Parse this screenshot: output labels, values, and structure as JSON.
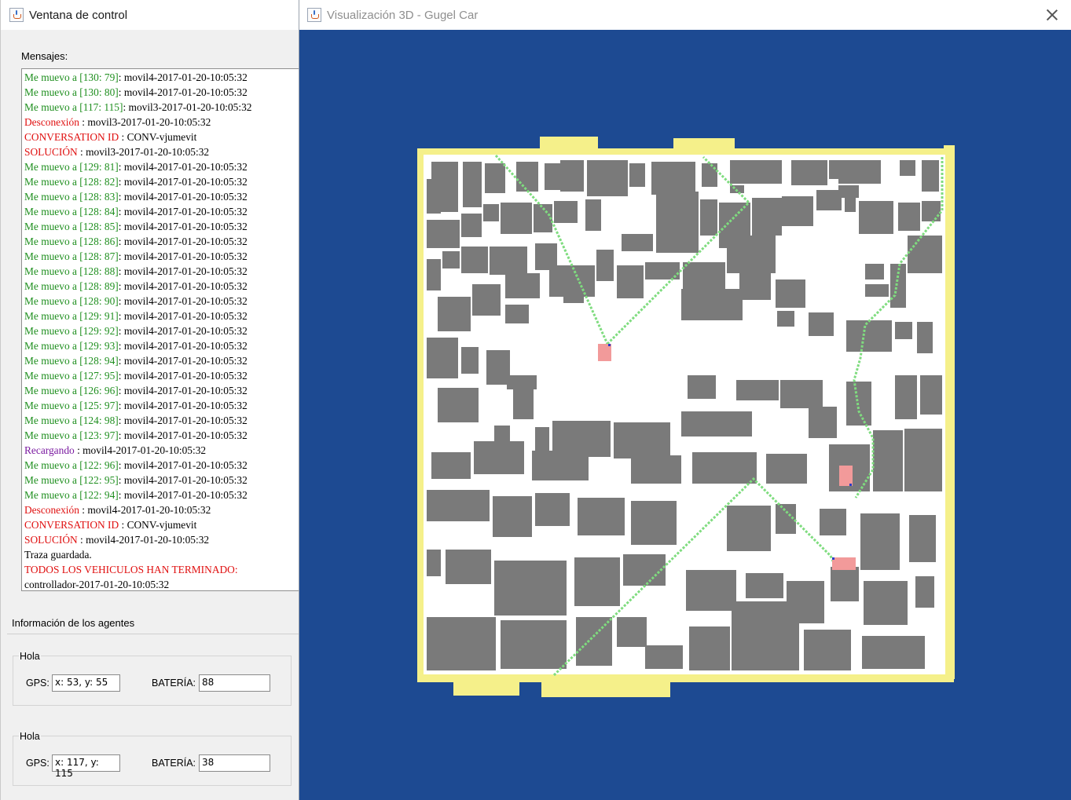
{
  "control_window": {
    "title": "Ventana de control",
    "messages_label": "Mensajes:",
    "messages": [
      {
        "tag": "Me muevo a [130: 79]",
        "sep": ": ",
        "text": "movil4-2017-01-20-10:05:32",
        "color": "green"
      },
      {
        "tag": "Me muevo a [130: 80]",
        "sep": ": ",
        "text": "movil4-2017-01-20-10:05:32",
        "color": "green"
      },
      {
        "tag": "Me muevo a [117: 115]",
        "sep": ": ",
        "text": "movil3-2017-01-20-10:05:32",
        "color": "green"
      },
      {
        "tag": "Desconexión",
        "sep": " : ",
        "text": "movil3-2017-01-20-10:05:32",
        "color": "red"
      },
      {
        "tag": "CONVERSATION ID",
        "sep": " : ",
        "text": "CONV-vjumevit",
        "color": "red"
      },
      {
        "tag": "SOLUCIÓN",
        "sep": " : ",
        "text": "movil3-2017-01-20-10:05:32",
        "color": "red"
      },
      {
        "tag": "Me muevo a [129: 81]",
        "sep": ": ",
        "text": "movil4-2017-01-20-10:05:32",
        "color": "green"
      },
      {
        "tag": "Me muevo a [128: 82]",
        "sep": ": ",
        "text": "movil4-2017-01-20-10:05:32",
        "color": "green"
      },
      {
        "tag": "Me muevo a [128: 83]",
        "sep": ": ",
        "text": "movil4-2017-01-20-10:05:32",
        "color": "green"
      },
      {
        "tag": "Me muevo a [128: 84]",
        "sep": ": ",
        "text": "movil4-2017-01-20-10:05:32",
        "color": "green"
      },
      {
        "tag": "Me muevo a [128: 85]",
        "sep": ": ",
        "text": "movil4-2017-01-20-10:05:32",
        "color": "green"
      },
      {
        "tag": "Me muevo a [128: 86]",
        "sep": ": ",
        "text": "movil4-2017-01-20-10:05:32",
        "color": "green"
      },
      {
        "tag": "Me muevo a [128: 87]",
        "sep": ": ",
        "text": "movil4-2017-01-20-10:05:32",
        "color": "green"
      },
      {
        "tag": "Me muevo a [128: 88]",
        "sep": ": ",
        "text": "movil4-2017-01-20-10:05:32",
        "color": "green"
      },
      {
        "tag": "Me muevo a [128: 89]",
        "sep": ": ",
        "text": "movil4-2017-01-20-10:05:32",
        "color": "green"
      },
      {
        "tag": "Me muevo a [128: 90]",
        "sep": ": ",
        "text": "movil4-2017-01-20-10:05:32",
        "color": "green"
      },
      {
        "tag": "Me muevo a [129: 91]",
        "sep": ": ",
        "text": "movil4-2017-01-20-10:05:32",
        "color": "green"
      },
      {
        "tag": "Me muevo a [129: 92]",
        "sep": ": ",
        "text": "movil4-2017-01-20-10:05:32",
        "color": "green"
      },
      {
        "tag": "Me muevo a [129: 93]",
        "sep": ": ",
        "text": "movil4-2017-01-20-10:05:32",
        "color": "green"
      },
      {
        "tag": "Me muevo a [128: 94]",
        "sep": ": ",
        "text": "movil4-2017-01-20-10:05:32",
        "color": "green"
      },
      {
        "tag": "Me muevo a [127: 95]",
        "sep": ": ",
        "text": "movil4-2017-01-20-10:05:32",
        "color": "green"
      },
      {
        "tag": "Me muevo a [126: 96]",
        "sep": ": ",
        "text": "movil4-2017-01-20-10:05:32",
        "color": "green"
      },
      {
        "tag": "Me muevo a [125: 97]",
        "sep": ": ",
        "text": "movil4-2017-01-20-10:05:32",
        "color": "green"
      },
      {
        "tag": "Me muevo a [124: 98]",
        "sep": ": ",
        "text": "movil4-2017-01-20-10:05:32",
        "color": "green"
      },
      {
        "tag": "Me muevo a [123: 97]",
        "sep": ": ",
        "text": "movil4-2017-01-20-10:05:32",
        "color": "green"
      },
      {
        "tag": "Recargando",
        "sep": " : ",
        "text": "movil4-2017-01-20-10:05:32",
        "color": "purple"
      },
      {
        "tag": "Me muevo a [122: 96]",
        "sep": ": ",
        "text": "movil4-2017-01-20-10:05:32",
        "color": "green"
      },
      {
        "tag": "Me muevo a [122: 95]",
        "sep": ": ",
        "text": "movil4-2017-01-20-10:05:32",
        "color": "green"
      },
      {
        "tag": "Me muevo a [122: 94]",
        "sep": ": ",
        "text": "movil4-2017-01-20-10:05:32",
        "color": "green"
      },
      {
        "tag": "Desconexión",
        "sep": " : ",
        "text": "movil4-2017-01-20-10:05:32",
        "color": "red"
      },
      {
        "tag": "CONVERSATION ID",
        "sep": " : ",
        "text": "CONV-vjumevit",
        "color": "red"
      },
      {
        "tag": "SOLUCIÓN",
        "sep": " : ",
        "text": "movil4-2017-01-20-10:05:32",
        "color": "red"
      },
      {
        "tag": "",
        "sep": "",
        "text": "Traza guardada.",
        "color": "black"
      },
      {
        "tag": "TODOS LOS VEHICULOS HAN TERMINADO:",
        "sep": "",
        "text": "",
        "color": "red"
      },
      {
        "tag": "",
        "sep": "",
        "text": "controllador-2017-01-20-10:05:32",
        "color": "black"
      }
    ],
    "agents_label": "Información de los agentes",
    "agents": [
      {
        "title": "Hola",
        "gps_label": "GPS:",
        "gps_value": "x: 53, y: 55",
        "battery_label": "BATERÍA:",
        "battery_value": "88"
      },
      {
        "title": "Hola",
        "gps_label": "GPS:",
        "gps_value": "x: 117, y: 115",
        "battery_label": "BATERÍA:",
        "battery_value": "38"
      }
    ]
  },
  "viz_window": {
    "title": "Visualización 3D - Gugel Car",
    "colors": {
      "background": "#1d4a92",
      "board_border": "#f5f08a",
      "road": "#ffffff",
      "building": "#7a7a7a",
      "path": "#7fdc7f",
      "vehicle": "#f29a9a"
    }
  }
}
